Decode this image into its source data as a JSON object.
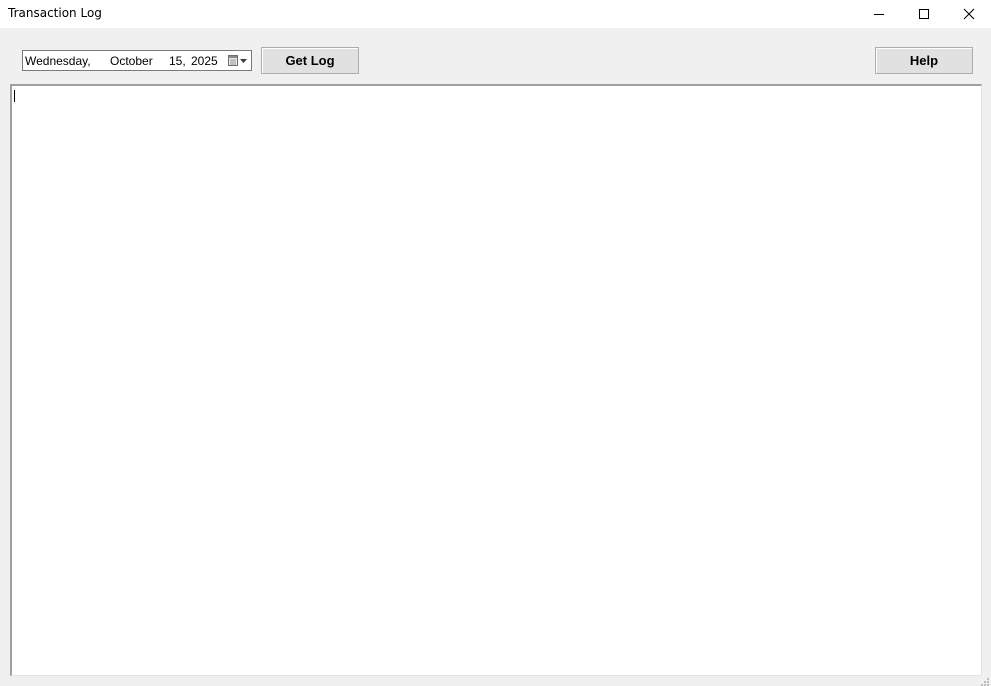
{
  "window": {
    "title": "Transaction Log"
  },
  "toolbar": {
    "date": {
      "weekday": "Wednesday,",
      "month": "October",
      "day": "15,",
      "year": "2025"
    },
    "get_log_label": "Get Log",
    "help_label": "Help"
  },
  "log": {
    "content": ""
  },
  "icons": {
    "minimize": "minimize-icon",
    "maximize": "maximize-icon",
    "close": "close-icon",
    "calendar": "calendar-dropdown-icon"
  },
  "colors": {
    "background": "#f0f0f0",
    "button_face": "#e1e1e1",
    "text": "#000000"
  }
}
